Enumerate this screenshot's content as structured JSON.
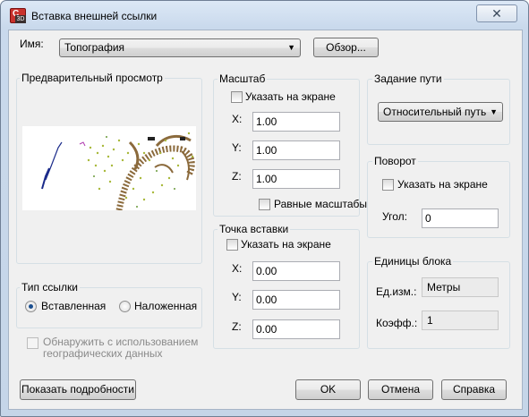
{
  "window": {
    "title": "Вставка внешней ссылки",
    "close_label": "✕",
    "app_icon_letter": "C",
    "app_icon_tag": "3D"
  },
  "name_row": {
    "label": "Имя:",
    "value": "Топография",
    "browse_label": "Обзор..."
  },
  "preview": {
    "title": "Предварительный просмотр"
  },
  "reference_type": {
    "title": "Тип ссылки",
    "options": [
      {
        "label": "Вставленная",
        "selected": true
      },
      {
        "label": "Наложенная",
        "selected": false
      }
    ]
  },
  "geo_checkbox": {
    "label_line1": "Обнаружить с использованием",
    "label_line2": "географических данных",
    "checked": false,
    "enabled": false
  },
  "scale": {
    "title": "Масштаб",
    "specify_on_screen": "Указать на экране",
    "x_label": "X:",
    "x_value": "1.00",
    "y_label": "Y:",
    "y_value": "1.00",
    "z_label": "Z:",
    "z_value": "1.00",
    "uniform_label": "Равные масштабы"
  },
  "insertion_point": {
    "title": "Точка вставки",
    "specify_on_screen": "Указать на экране",
    "x_label": "X:",
    "x_value": "0.00",
    "y_label": "Y:",
    "y_value": "0.00",
    "z_label": "Z:",
    "z_value": "0.00"
  },
  "path_type": {
    "title": "Задание пути",
    "value": "Относительный путь"
  },
  "rotation": {
    "title": "Поворот",
    "specify_on_screen": "Указать на экране",
    "angle_label": "Угол:",
    "angle_value": "0"
  },
  "block_unit": {
    "title": "Единицы блока",
    "unit_label": "Ед.изм.:",
    "unit_value": "Метры",
    "factor_label": "Коэфф.:",
    "factor_value": "1"
  },
  "footer": {
    "details_label": "Показать подробности",
    "ok_label": "OK",
    "cancel_label": "Отмена",
    "help_label": "Справка"
  },
  "colors": {
    "title_gradient_top": "#dce8f6",
    "client_bg": "#f0f0f0",
    "radio_dot": "#1b4f8f",
    "map_contour": "#8b6a3c",
    "map_points": "#a8b83a",
    "map_lines": "#1a2a8a"
  }
}
